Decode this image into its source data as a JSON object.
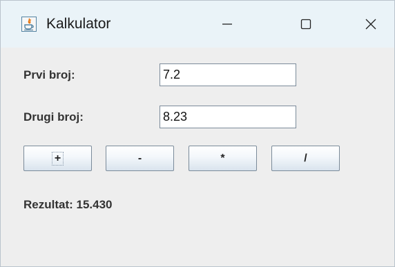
{
  "window": {
    "title": "Kalkulator",
    "icon": "java-icon",
    "controls": {
      "minimize_icon": "minimize-icon",
      "maximize_icon": "maximize-icon",
      "close_icon": "close-icon"
    }
  },
  "form": {
    "first_label": "Prvi broj:",
    "first_value": "7.2",
    "second_label": "Drugi broj:",
    "second_value": "8.23"
  },
  "operations": {
    "add_label": "+",
    "subtract_label": "-",
    "multiply_label": "*",
    "divide_label": "/"
  },
  "result": {
    "text": "Rezultat: 15.430"
  },
  "colors": {
    "titlebar": "#eaf3f8",
    "content_background": "#eeeeee",
    "button_border": "#7a8a99",
    "java_icon_orange": "#e76f00",
    "java_icon_blue": "#5382a1"
  }
}
